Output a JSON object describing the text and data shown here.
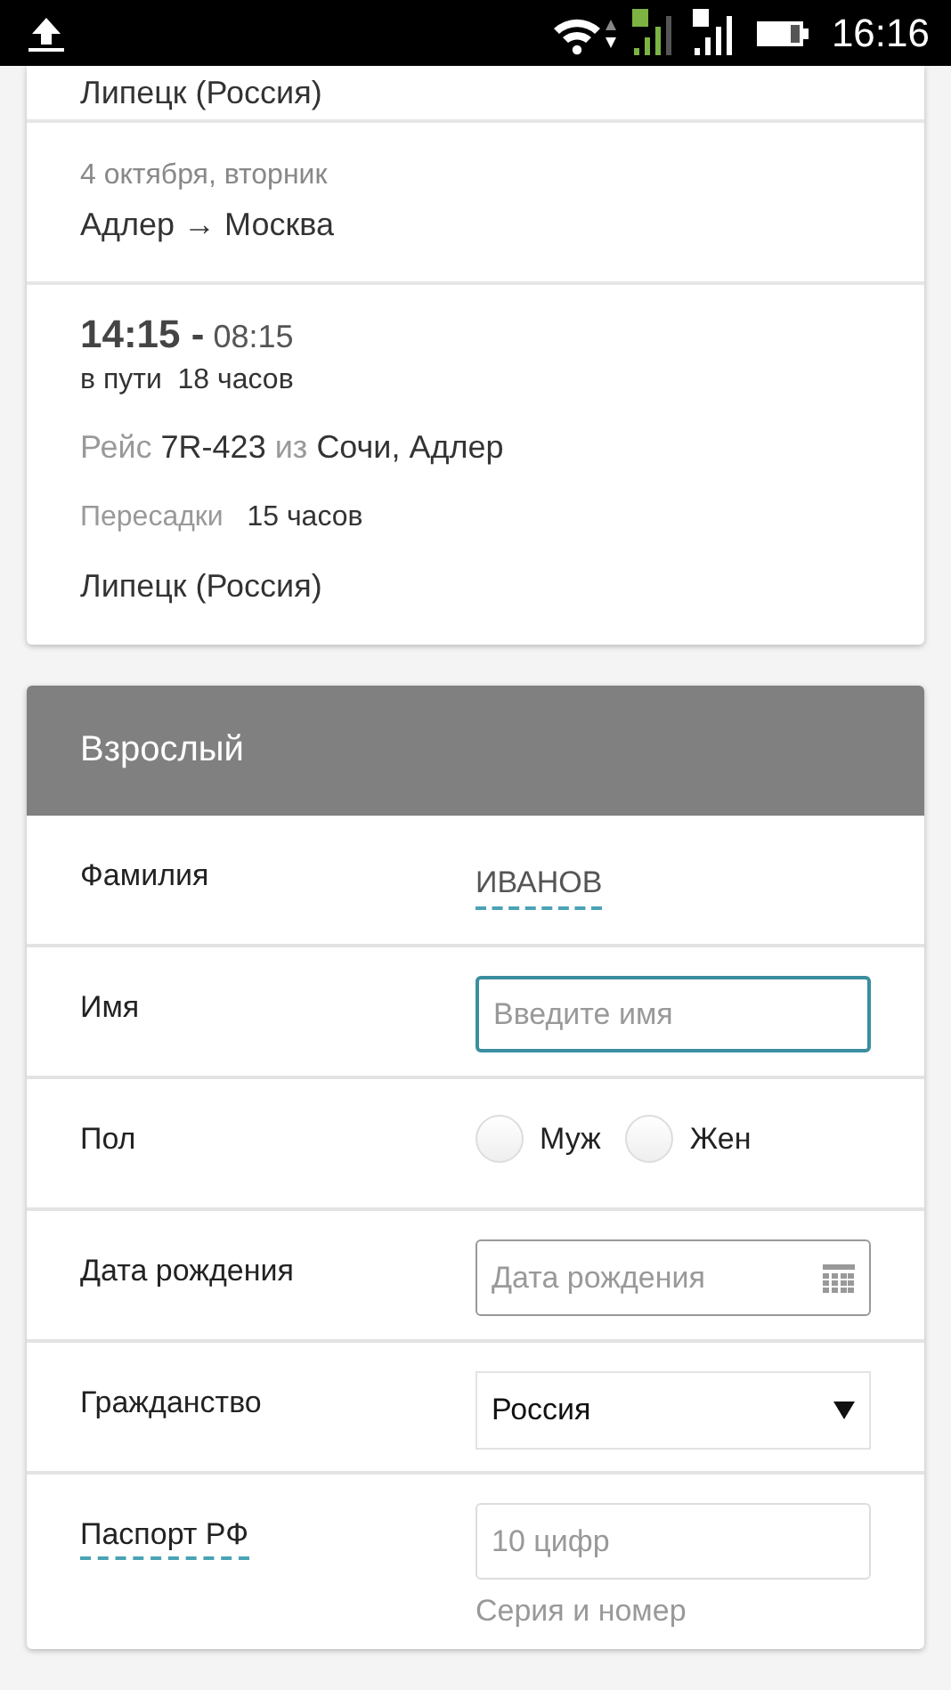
{
  "status_bar": {
    "time": "16:16"
  },
  "itinerary": {
    "previous_destination": "Липецк (Россия)",
    "segment": {
      "date": "4 октября, вторник",
      "route": "Адлер → Москва"
    },
    "flight": {
      "departure": "14:15 -",
      "arrival": "08:15",
      "duration_label": "в пути",
      "duration": "18 часов",
      "flight_label": "Рейс",
      "flight_number": "7R-423",
      "from_label": "из",
      "from": "Сочи, Адлер",
      "transfer_label": "Пересадки",
      "transfer": "15 часов",
      "destination": "Липецк (Россия)"
    }
  },
  "passenger": {
    "title": "Взрослый",
    "fields": [
      {
        "kind": "text",
        "dashed_label": false,
        "label": "Фамилия",
        "value": "ИВАНОВ"
      },
      {
        "kind": "input",
        "dashed_label": false,
        "label": "Имя",
        "placeholder": "Введите имя",
        "focused": true
      },
      {
        "kind": "radio",
        "dashed_label": false,
        "label": "Пол",
        "options": [
          {
            "label": "Муж",
            "selected": false
          },
          {
            "label": "Жен",
            "selected": false
          }
        ]
      },
      {
        "kind": "date",
        "dashed_label": false,
        "label": "Дата рождения",
        "placeholder": "Дата рождения"
      },
      {
        "kind": "select",
        "dashed_label": false,
        "label": "Гражданство",
        "value": "Россия"
      },
      {
        "kind": "input",
        "label": "Паспорт РФ",
        "dashed_label": true,
        "placeholder": "10 цифр",
        "hint": "Серия и номер",
        "focused": false
      }
    ]
  }
}
